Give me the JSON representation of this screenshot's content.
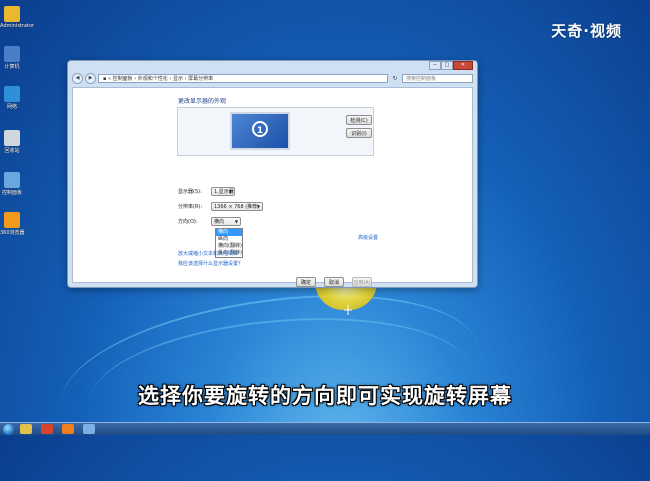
{
  "watermark": "天奇·视频",
  "subtitle": "选择你要旋转的方向即可实现旋转屏幕",
  "desktop_icons": [
    {
      "label": "Administrator",
      "color": "#e8b830"
    },
    {
      "label": "计算机",
      "color": "#4a7fc8"
    },
    {
      "label": "网络",
      "color": "#2f8fd8"
    },
    {
      "label": "回收站",
      "color": "#cfd6de"
    },
    {
      "label": "控制面板",
      "color": "#6aa6e0"
    },
    {
      "label": "360浏览器",
      "color": "#f29a1c"
    }
  ],
  "window": {
    "min_label": "─",
    "max_label": "□",
    "close_label": "✕",
    "back_icon": "◀",
    "forward_icon": "▶",
    "address": "▪ « 控制面板 › 外观和个性化 › 显示 › 屏幕分辨率",
    "refresh_icon": "↻",
    "search_placeholder": "搜索控制面板",
    "title": "更改显示器的外观",
    "detect_button": "检测(C)",
    "identify_button": "识别(I)",
    "monitor_number": "1",
    "display_label": "显示器(S):",
    "display_value": "1.显示器",
    "resolution_label": "分辨率(R):",
    "resolution_value": "1366 × 768 (推荐)",
    "orientation_label": "方向(O):",
    "orientation_value": "横向",
    "orientation_options": [
      "横向",
      "纵向",
      "横向(翻转)",
      "纵向(翻转)"
    ],
    "advanced_link": "高级设置",
    "link_text_size": "放大或缩小文本和其他项目",
    "link_which_settings": "我应该选择什么显示器设置?",
    "ok_button": "确定",
    "cancel_button": "取消",
    "apply_button": "应用(A)"
  },
  "taskbar": {
    "icons": [
      {
        "name": "explorer",
        "color": "#e3c14a"
      },
      {
        "name": "chrome",
        "color": "#d9452c"
      },
      {
        "name": "app",
        "color": "#f07e1a"
      },
      {
        "name": "display",
        "color": "#7ab0e6"
      }
    ]
  }
}
